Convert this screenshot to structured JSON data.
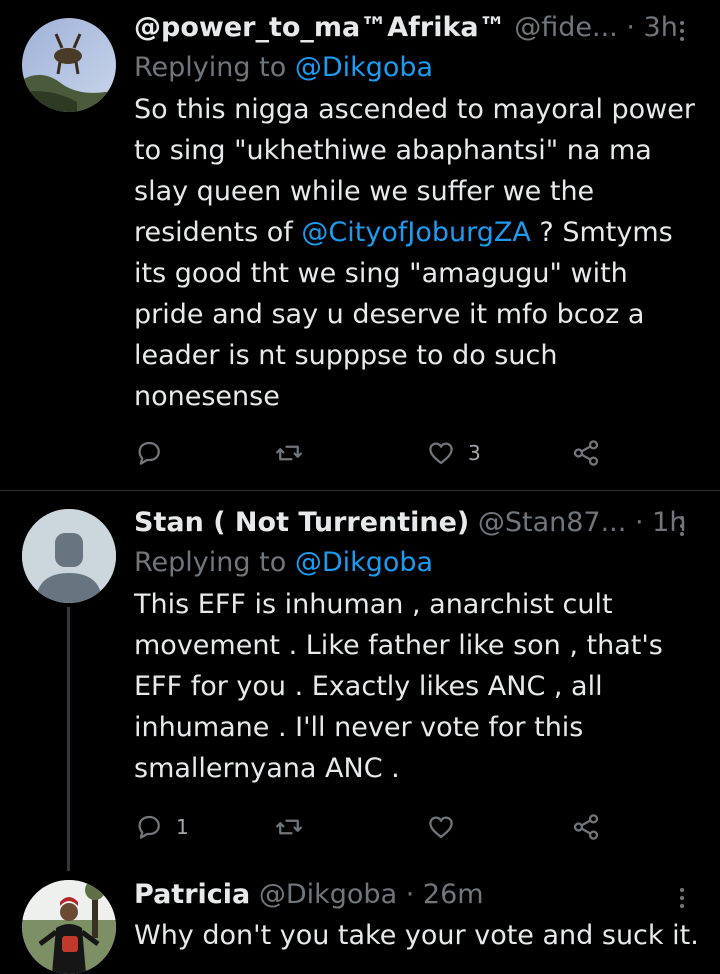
{
  "tweets": [
    {
      "name": "@power_to_ma™Afrika™",
      "handle": "@fide...",
      "sep": "·",
      "time": "3h",
      "replying_prefix": "Replying to",
      "replying_to": "@Dikgoba",
      "body_parts": [
        "So this nigga ascended to mayoral power to sing \"ukhethiwe abaphantsi\" na ma slay queen while we suffer we the residents of ",
        "@CityofJoburgZA",
        " ? Smtyms its good tht we sing \"amagugu\" with pride and say u deserve it mfo bcoz a leader is nt supppse to do such nonesense"
      ],
      "reply_count": "",
      "retweet_count": "",
      "like_count": "3"
    },
    {
      "name": "Stan ( Not Turrentine)",
      "handle": "@Stan87...",
      "sep": "·",
      "time": "1h",
      "replying_prefix": "Replying to",
      "replying_to": "@Dikgoba",
      "body": "This EFF is inhuman , anarchist cult movement . Like father like son , that's EFF for you . Exactly likes ANC , all inhumane . I'll never vote for this smallernyana ANC .",
      "reply_count": "1",
      "retweet_count": "",
      "like_count": ""
    },
    {
      "name": "Patricia",
      "handle": "@Dikgoba",
      "sep": "·",
      "time": "26m",
      "body": "Why don't you take your vote and suck it."
    }
  ],
  "icons": [
    "reply-icon",
    "retweet-icon",
    "like-icon",
    "share-icon",
    "more-icon"
  ],
  "colors": {
    "background": "#000000",
    "text": "#e7e9ea",
    "muted": "#71767b",
    "link": "#1d9bf0"
  }
}
